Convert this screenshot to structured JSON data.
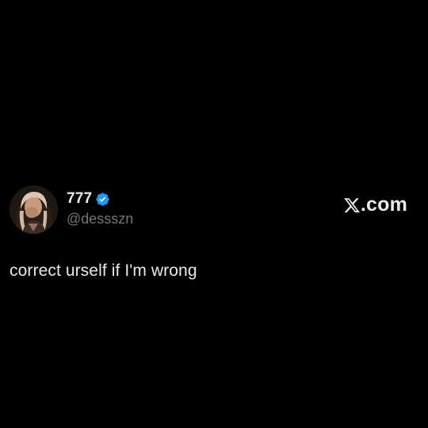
{
  "tweet": {
    "author": {
      "display_name": "777",
      "handle": "@dessszn",
      "verified": true,
      "verified_color": "#1d9bf0",
      "avatar_icon": "user-avatar-photo"
    },
    "text": "correct urself if I'm wrong",
    "brand": {
      "logo_letter": "X",
      "suffix": ".com",
      "icon": "x-logo-icon"
    }
  },
  "colors": {
    "background": "#000000",
    "primary_text": "#e7e9ea",
    "secondary_text": "#71767b",
    "accent": "#1d9bf0"
  }
}
